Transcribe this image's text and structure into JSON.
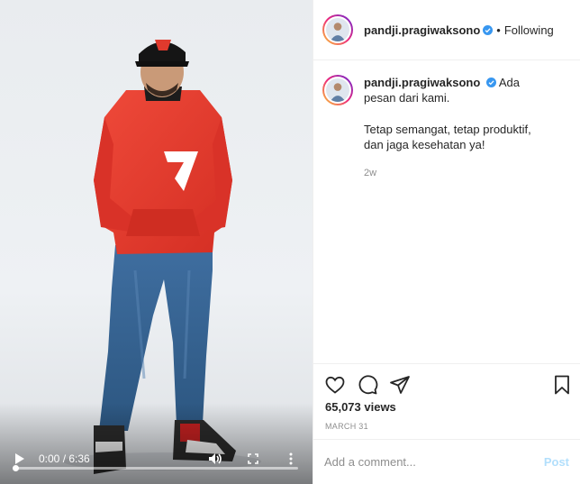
{
  "post": {
    "username": "pandji.pragiwaksono",
    "follow_label": "Following",
    "dot": "•",
    "caption_line1": "Ada pesan dari kami.",
    "caption_line2": "Tetap semangat, tetap produktif, dan jaga kesehatan ya!",
    "time_ago": "2w",
    "views": "65,073 views",
    "date": "MARCH 31"
  },
  "video": {
    "time_display": "0:00 / 6:36",
    "progress": 0
  },
  "comment_box": {
    "placeholder": "Add a comment...",
    "post_label": "Post"
  },
  "icons": {
    "play": "play-icon",
    "volume": "volume-icon",
    "fullscreen": "fullscreen-icon",
    "more": "more-vertical-icon",
    "like": "heart-icon",
    "comment": "comment-icon",
    "share": "paper-plane-icon",
    "save": "bookmark-icon",
    "verified": "verified-badge-icon"
  },
  "colors": {
    "accent_blue": "#0095f6",
    "post_disabled": "#b2dffc",
    "hoodie_red": "#e53a2d",
    "muted_text": "#8e8e8e"
  }
}
